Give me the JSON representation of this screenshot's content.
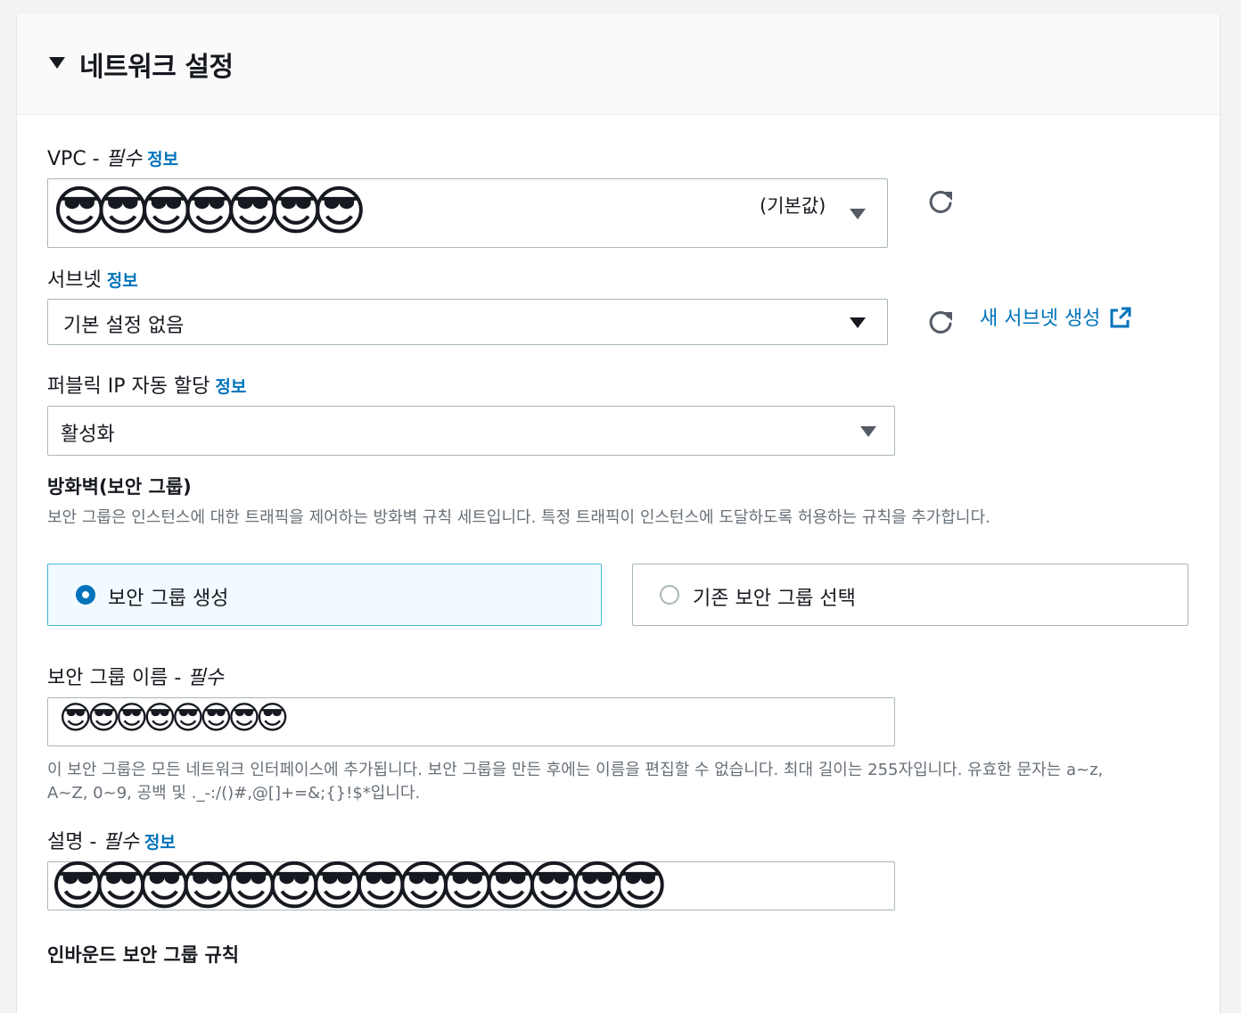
{
  "header": {
    "title": "네트워크 설정"
  },
  "vpc": {
    "label": "VPC",
    "required_suffix": "필수",
    "info": "정보",
    "value_obscured_text": "😎😎😎😎😎😎😎",
    "default_tag": "(기본값)"
  },
  "subnet": {
    "label": "서브넷",
    "info": "정보",
    "value": "기본 설정 없음",
    "create_link": "새 서브넷 생성"
  },
  "public_ip": {
    "label": "퍼블릭 IP 자동 할당",
    "info": "정보",
    "value": "활성화"
  },
  "firewall": {
    "title": "방화벽(보안 그룹)",
    "description": "보안 그룹은 인스턴스에 대한 트래픽을 제어하는 방화벽 규칙 세트입니다. 특정 트래픽이 인스턴스에 도달하도록 허용하는 규칙을 추가합니다.",
    "option_create": "보안 그룹 생성",
    "option_existing": "기존 보안 그룹 선택"
  },
  "sg_name": {
    "label": "보안 그룹 이름",
    "required_suffix": "필수",
    "value_obscured_text": "😎😎😎😎😎😎😎😎",
    "help_line1": "이 보안 그룹은 모든 네트워크 인터페이스에 추가됩니다. 보안 그룹을 만든 후에는 이름을 편집할 수 없습니다. 최대 길이는 255자입니다. 유효한 문자는 a~z,",
    "help_line2": "A~Z, 0~9, 공백 및 ._-:/()#,@[]+=&;{}!$*입니다."
  },
  "description_field": {
    "label": "설명",
    "required_suffix": "필수",
    "info": "정보",
    "value_obscured_text": "😎😎😎😎😎😎😎😎😎😎😎😎😎😎"
  },
  "inbound": {
    "title": "인바운드 보안 그룹 규칙"
  },
  "colors": {
    "link": "#0073bb",
    "selected_bg": "#f1faff",
    "border": "#aab7b8"
  }
}
